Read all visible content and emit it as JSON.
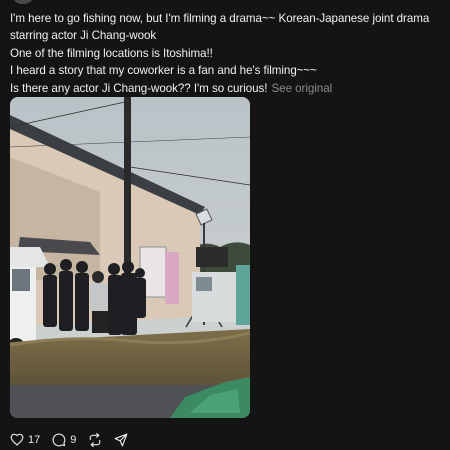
{
  "post": {
    "lines": [
      "I'm here to go fishing now, but I'm filming a drama~~ Korean-Japanese joint drama",
      "starring actor Ji Chang-wook",
      "One of the filming locations is Itoshima!!",
      "I heard a story that my coworker is a fan and he's filming~~~",
      "Is there any actor Ji Chang-wook?? I'm so curious!"
    ],
    "see_original_label": "See original"
  },
  "actions": {
    "like": {
      "icon": "heart-icon",
      "count": "17"
    },
    "comment": {
      "icon": "comment-bubble-icon",
      "count": "9"
    },
    "repost": {
      "icon": "repost-icon"
    },
    "share": {
      "icon": "share-send-icon"
    }
  },
  "colors": {
    "background": "#141414",
    "text": "#f1f1f1",
    "muted": "#8a8a8a"
  }
}
